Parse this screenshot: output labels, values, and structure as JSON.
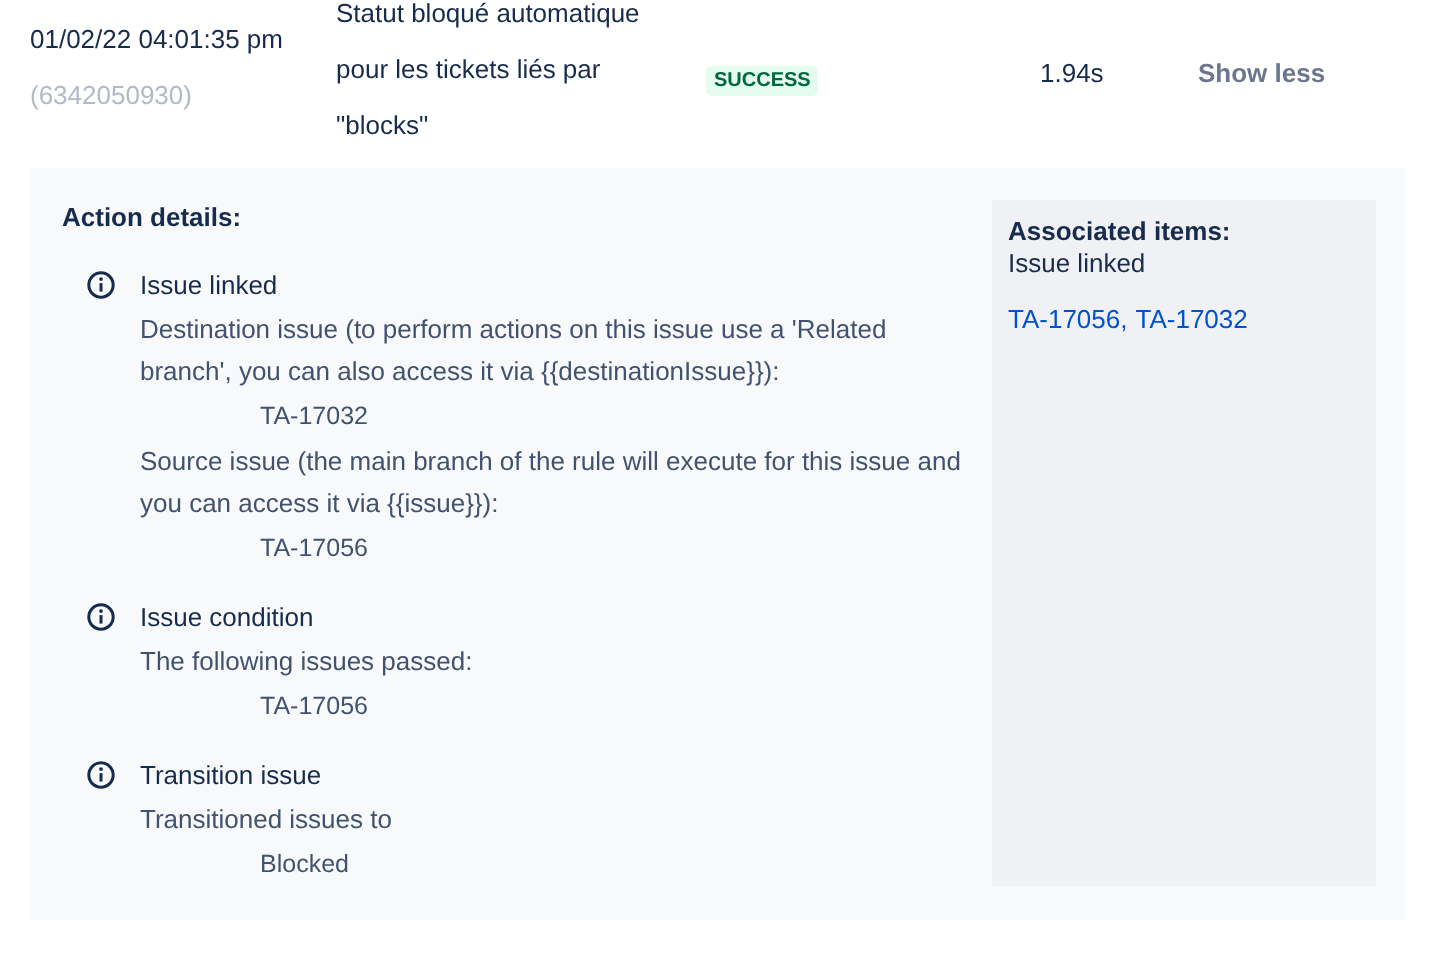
{
  "row": {
    "date": "01/02/22 04:01:35 pm",
    "execution_id": "(6342050930)",
    "description": "Statut bloqué automatique pour les tickets liés par \"blocks\"",
    "status": {
      "label": "SUCCESS",
      "kind": "success"
    },
    "duration": "1.94s",
    "toggle": "Show less"
  },
  "details": {
    "title": "Action details:",
    "actions": [
      {
        "title": "Issue linked",
        "entries": [
          {
            "text": "Destination issue (to perform actions on this issue use a 'Related branch', you can also access it via {{destinationIssue}}):",
            "value": "TA-17032"
          },
          {
            "text": "Source issue (the main branch of the rule will execute for this issue and you can access it via {{issue}}):",
            "value": "TA-17056"
          }
        ]
      },
      {
        "title": "Issue condition",
        "entries": [
          {
            "text": "The following issues passed:",
            "value": "TA-17056"
          }
        ]
      },
      {
        "title": "Transition issue",
        "entries": [
          {
            "text": "Transitioned issues to",
            "value": "Blocked"
          }
        ]
      }
    ],
    "associated": {
      "title": "Associated items:",
      "subtitle": "Issue linked",
      "links": [
        "TA-17056,",
        "TA-17032"
      ]
    }
  }
}
